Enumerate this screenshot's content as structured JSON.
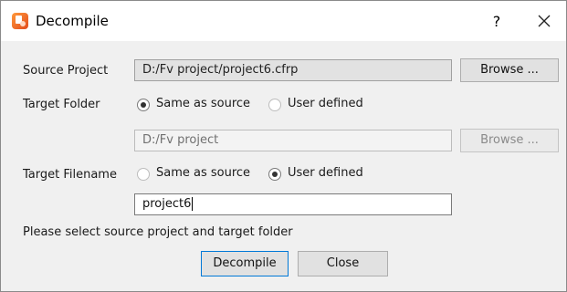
{
  "window": {
    "title": "Decompile",
    "help_label": "?",
    "app_icon": "decompile-app-icon",
    "close_icon": "close-icon"
  },
  "source_project": {
    "label": "Source Project",
    "value": "D:/Fv project/project6.cfrp",
    "browse_label": "Browse ..."
  },
  "target_folder": {
    "label": "Target Folder",
    "options": [
      {
        "label": "Same as source",
        "selected": true
      },
      {
        "label": "User defined",
        "selected": false
      }
    ],
    "value": "D:/Fv project",
    "browse_label": "Browse ...",
    "browse_enabled": false
  },
  "target_filename": {
    "label": "Target Filename",
    "options": [
      {
        "label": "Same as source",
        "selected": false
      },
      {
        "label": "User defined",
        "selected": true
      }
    ],
    "value": "project6"
  },
  "status_text": "Please select source project and target folder",
  "actions": {
    "decompile_label": "Decompile",
    "close_label": "Close"
  },
  "colors": {
    "title_bar": "#ffffff",
    "dialog_bg": "#f0f0f0",
    "readonly_field": "#e2e2e2",
    "button": "#e1e1e1"
  }
}
